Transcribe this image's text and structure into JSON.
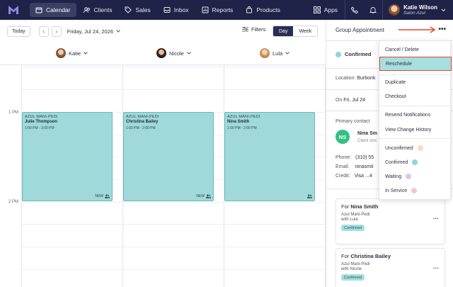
{
  "nav": {
    "items": [
      {
        "label": "Calendar",
        "icon": "calendar-icon",
        "active": true
      },
      {
        "label": "Clients",
        "icon": "clients-icon"
      },
      {
        "label": "Sales",
        "icon": "tag-icon"
      },
      {
        "label": "Inbox",
        "icon": "inbox-icon"
      },
      {
        "label": "Reports",
        "icon": "chart-icon"
      },
      {
        "label": "Products",
        "icon": "bag-icon"
      }
    ],
    "apps_label": "Apps",
    "user_name": "Katie Wilson",
    "salon": "Salon Azul"
  },
  "toolbar": {
    "today": "Today",
    "date": "Friday, Jul 24, 2026",
    "filters": "Filters",
    "day": "Day",
    "week": "Week"
  },
  "staff": [
    {
      "name": "Katie"
    },
    {
      "name": "Nicole"
    },
    {
      "name": "Lula"
    }
  ],
  "time_labels": [
    "1 PM",
    "2 PM"
  ],
  "appointments": [
    {
      "service": "AZUL MANI-PEDI",
      "client": "Julie Thompson",
      "time": "1:00 PM - 2:00 PM",
      "badge": "NEW"
    },
    {
      "service": "AZUL MANI-PEDI",
      "client": "Christina Bailey",
      "time": "1:00 PM - 2:00 PM",
      "badge": "NEW"
    },
    {
      "service": "AZUL MANI-PEDI",
      "client": "Nina Smith",
      "time": "1:00 PM - 2:00 PM",
      "badge": ""
    }
  ],
  "panel": {
    "title": "Group Appointment",
    "status": "Confirmed",
    "location_label": "Location:",
    "location_value": "Burbonk",
    "date_prefix": "On",
    "date_value": "Fri, Jul 24",
    "primary_contact_label": "Primary contact",
    "contact_initials": "NS",
    "contact_name": "Nina Sm",
    "contact_sub": "Client sinc",
    "phone_label": "Phone:",
    "phone_value": "(310) 55",
    "email_label": "Email:",
    "email_value": "ninasmit",
    "credit_label": "Credit:",
    "credit_value": "Visa  ...4",
    "cards": [
      {
        "for_prefix": "For",
        "name": "Nina Smith",
        "service": "Azul Mani-Pedi",
        "with": "with Lula",
        "status": "Confirmed"
      },
      {
        "for_prefix": "For",
        "name": "Christina Bailey",
        "service": "Azul Mani-Pedi",
        "with": "with Nicole",
        "status": "Confirmed"
      }
    ]
  },
  "menu": {
    "items": [
      {
        "label": "Cancel / Delete"
      },
      {
        "label": "Reschedule",
        "highlighted": true
      },
      {
        "label": "Duplicate"
      },
      {
        "label": "Checkout"
      },
      {
        "label": "Resend Notifications"
      },
      {
        "label": "View Change History"
      },
      {
        "label": "Unconfirmed",
        "dot": "#f7dcc4"
      },
      {
        "label": "Confirmed",
        "dot": "#8fd6d6"
      },
      {
        "label": "Waiting",
        "dot": "#d7c8f0"
      },
      {
        "label": "In Service",
        "dot": "#f5c6d2"
      }
    ]
  },
  "colors": {
    "nav_bg": "#1f2347",
    "appointment_fill": "#9fd9d9",
    "highlight_border": "#e8442d",
    "contact_avatar": "#34c083"
  }
}
